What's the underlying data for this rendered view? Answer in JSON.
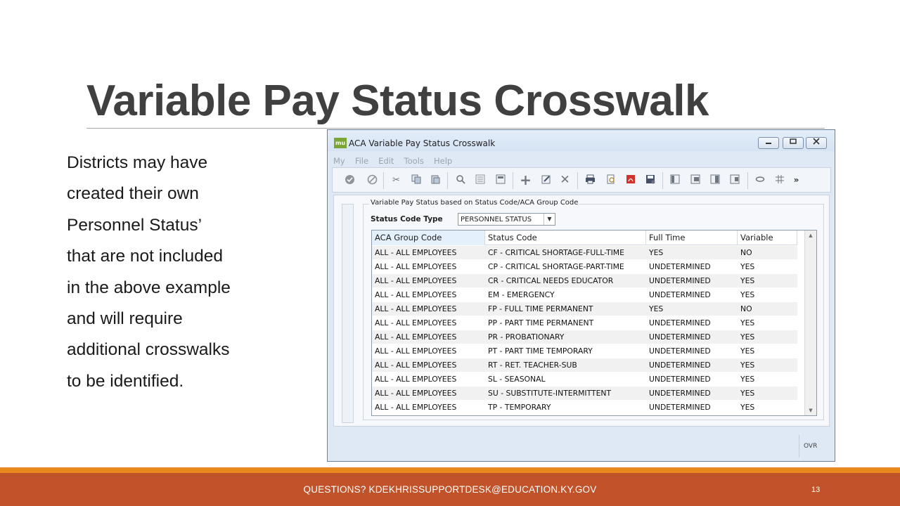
{
  "slide": {
    "title": "Variable Pay Status Crosswalk",
    "body_lines": [
      "Districts may have",
      "created their own",
      "Personnel Status’",
      "that are not included",
      "in the above example",
      "and will require",
      "additional crosswalks",
      "to be identified."
    ],
    "footer_text": "QUESTIONS?  KDEKHRISSUPPORTDESK@EDUCATION.KY.GOV",
    "page_number": "13"
  },
  "window": {
    "logo": "mu",
    "title": "ACA Variable Pay Status Crosswalk",
    "controls": [
      "minimize",
      "maximize",
      "close"
    ],
    "menu": [
      "My",
      "File",
      "Edit",
      "Tools",
      "Help"
    ],
    "toolbar_icons": [
      "check-icon",
      "cancel-icon",
      "cut-icon",
      "copy-icon",
      "paste-icon",
      "search-icon",
      "list-icon",
      "form-icon",
      "add-icon",
      "edit-icon",
      "delete-icon",
      "print-icon",
      "print-preview-icon",
      "pdf-icon",
      "save-icon",
      "view1-icon",
      "view2-icon",
      "view3-icon",
      "view4-icon",
      "attach-icon",
      "grid-icon",
      "more-icon"
    ],
    "group_title": "Variable Pay Status based on Status Code/ACA Group Code",
    "status_code_type_label": "Status Code Type",
    "status_code_type_value": "PERSONNEL STATUS",
    "columns": [
      "ACA Group Code",
      "Status Code",
      "Full Time",
      "Variable"
    ],
    "rows": [
      [
        "ALL - ALL EMPLOYEES",
        "CF - CRITICAL SHORTAGE-FULL-TIME",
        "YES",
        "NO"
      ],
      [
        "ALL - ALL EMPLOYEES",
        "CP - CRITICAL SHORTAGE-PART-TIME",
        "UNDETERMINED",
        "YES"
      ],
      [
        "ALL - ALL EMPLOYEES",
        "CR - CRITICAL NEEDS EDUCATOR",
        "UNDETERMINED",
        "YES"
      ],
      [
        "ALL - ALL EMPLOYEES",
        "EM - EMERGENCY",
        "UNDETERMINED",
        "YES"
      ],
      [
        "ALL - ALL EMPLOYEES",
        "FP - FULL TIME PERMANENT",
        "YES",
        "NO"
      ],
      [
        "ALL - ALL EMPLOYEES",
        "PP - PART TIME PERMANENT",
        "UNDETERMINED",
        "YES"
      ],
      [
        "ALL - ALL EMPLOYEES",
        "PR - PROBATIONARY",
        "UNDETERMINED",
        "YES"
      ],
      [
        "ALL - ALL EMPLOYEES",
        "PT - PART TIME TEMPORARY",
        "UNDETERMINED",
        "YES"
      ],
      [
        "ALL - ALL EMPLOYEES",
        "RT - RET. TEACHER-SUB",
        "UNDETERMINED",
        "YES"
      ],
      [
        "ALL - ALL EMPLOYEES",
        "SL - SEASONAL",
        "UNDETERMINED",
        "YES"
      ],
      [
        "ALL - ALL EMPLOYEES",
        "SU - SUBSTITUTE-INTERMITTENT",
        "UNDETERMINED",
        "YES"
      ],
      [
        "ALL - ALL EMPLOYEES",
        "TP - TEMPORARY",
        "UNDETERMINED",
        "YES"
      ]
    ],
    "status_bar": "OVR"
  },
  "colors": {
    "title": "#404040",
    "footer": "#c0532a",
    "footer_stripe": "#e8891e",
    "window_bg": "#dfe9f5"
  }
}
